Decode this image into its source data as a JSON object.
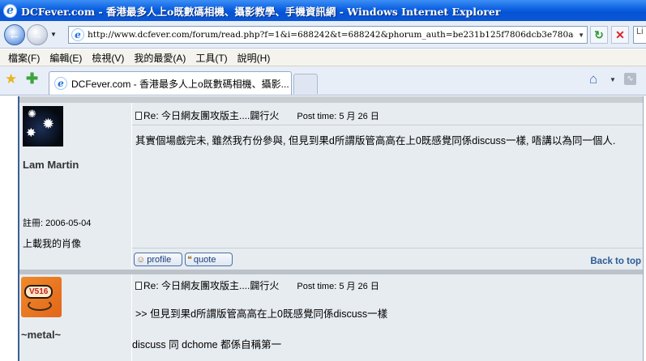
{
  "window": {
    "title": "DCFever.com - 香港最多人上o既數碼相機、攝影教學、手機資訊網 - Windows Internet Explorer"
  },
  "address_bar": {
    "url": "http://www.dcfever.com/forum/read.php?f=1&i=688242&t=688242&phorum_auth=be231b125f7806dcb3e780a490e06adc&pa",
    "search_placeholder": "Li"
  },
  "menu": [
    "檔案(F)",
    "編輯(E)",
    "檢視(V)",
    "我的最愛(A)",
    "工具(T)",
    "說明(H)"
  ],
  "tab": {
    "title": "DCFever.com - 香港最多人上o既數碼相機、攝影..."
  },
  "posts": [
    {
      "username": "Lam Martin",
      "registered": "註冊: 2006-05-04",
      "upload_link": "上載我的肖像",
      "subject": "Re: 今日網友團攻版主....闢行火",
      "post_time_label": "Post time:",
      "post_time": "5 月 26 日",
      "body": "其實個場戲完未, 雖然我冇份參與, 但見到果d所謂版管高高在上0既感覺同係discuss一樣, 唔講以為同一個人.",
      "profile_label": "profile",
      "quote_label": "quote",
      "back_to_top": "Back to top"
    },
    {
      "username": "~metal~",
      "avatar_text": "V516",
      "subject": "Re: 今日網友團攻版主....闢行火",
      "post_time_label": "Post time:",
      "post_time": "5 月 26 日",
      "quote_line": ">> 但見到果d所謂版管高高在上0既感覺同係discuss一樣",
      "body": "discuss 同 dchome 都係自稱第一"
    }
  ],
  "colors": {
    "title_bar": "#0a5fe0",
    "post_bg": "#e7ecf0",
    "link": "#2b5b96"
  }
}
